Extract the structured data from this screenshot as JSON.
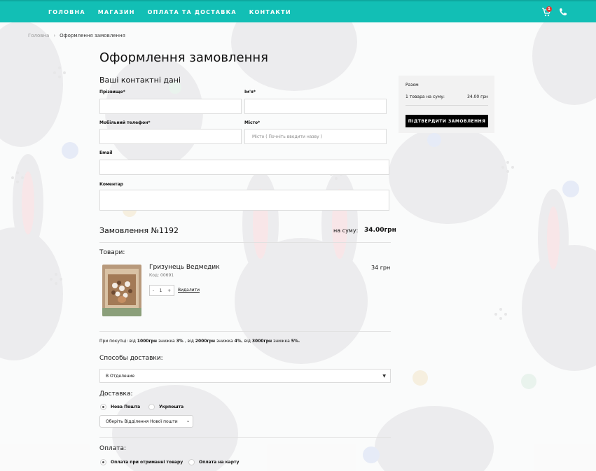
{
  "nav": {
    "items": [
      "ГОЛОВНА",
      "МАГАЗИН",
      "ОПЛАТА ТА ДОСТАВКА",
      "КОНТАКТИ"
    ],
    "cart_count": "1",
    "accent": "#12bfb5"
  },
  "breadcrumb": {
    "home": "Головна",
    "current": "Оформлення замовлення"
  },
  "page": {
    "title": "Оформлення замовлення",
    "contacts_title": "Ваші контактні дані"
  },
  "form": {
    "surname_label": "Прізвище*",
    "name_label": "Ім'я*",
    "phone_label": "Мобільний телефон*",
    "city_label": "Місто*",
    "city_placeholder": "Місто ( Почніть вводити назву )",
    "email_label": "Email",
    "comment_label": "Коментар"
  },
  "order": {
    "number": "Замовлення №1192",
    "sum_label": "на суму:",
    "sum": "34.00грн",
    "goods_label": "Товари:",
    "product": {
      "name": "Гризунець Ведмедик",
      "code": "Код: 00691",
      "price": "34 грн",
      "qty": "1",
      "minus": "-",
      "plus": "+",
      "delete": "Видалити"
    },
    "promo": {
      "p1": "При покупці: від ",
      "b1": "1000грн",
      "p2": " знижка ",
      "b2": "3%",
      "p3": " , від ",
      "b3": "2000грн",
      "p4": " знижка ",
      "b4": "4%",
      "p5": ", від ",
      "b5": "3000грн",
      "p6": " знижка ",
      "b6": "5%."
    },
    "delivery_methods_label": "Способы доставки:",
    "delivery_method": "В Отделение",
    "delivery_label": "Доставка:",
    "carrier_1": "Нова Пошта",
    "carrier_2": "Укрпошта",
    "branch_select": "Оберіть Відділення Нової пошти",
    "payment_label": "Оплата:",
    "payment_1": "Оплата при отриманні товару",
    "payment_2": "Оплата на карту"
  },
  "summary": {
    "title": "Разом",
    "items": "1 товара на суму:",
    "amount": "34.00 грн",
    "confirm": "ПІДТВЕРДИТИ ЗАМОВЛЕННЯ"
  }
}
